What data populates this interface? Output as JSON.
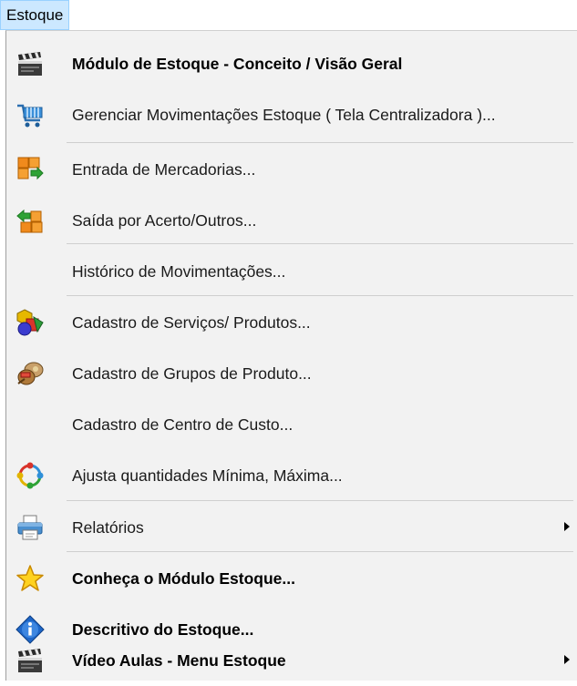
{
  "menubar": {
    "title": "Estoque"
  },
  "menu": {
    "items": [
      {
        "label": "Módulo de Estoque - Conceito / Visão Geral",
        "icon": "clapperboard-icon"
      },
      {
        "label": "Gerenciar Movimentações Estoque ( Tela Centralizadora )...",
        "icon": "shopping-cart-icon"
      },
      {
        "label": "Entrada de Mercadorias...",
        "icon": "stock-entry-icon"
      },
      {
        "label": "Saída por Acerto/Outros...",
        "icon": "stock-exit-icon"
      },
      {
        "label": "Histórico de Movimentações..."
      },
      {
        "label": "Cadastro de Serviços/ Produtos...",
        "icon": "product-shapes-icon"
      },
      {
        "label": "Cadastro de  Grupos de Produto...",
        "icon": "product-group-icon"
      },
      {
        "label": "Cadastro de Centro de Custo..."
      },
      {
        "label": "Ajusta quantidades Mínima, Máxima...",
        "icon": "sync-cycle-icon"
      },
      {
        "label": "Relatórios",
        "icon": "printer-icon",
        "submenu": true
      },
      {
        "label": "Conheça o Módulo Estoque...",
        "icon": "star-icon"
      },
      {
        "label": "Descritivo do Estoque...",
        "icon": "info-icon"
      },
      {
        "label": "Vídeo Aulas - Menu Estoque",
        "icon": "clapperboard-icon",
        "submenu": true
      }
    ]
  }
}
